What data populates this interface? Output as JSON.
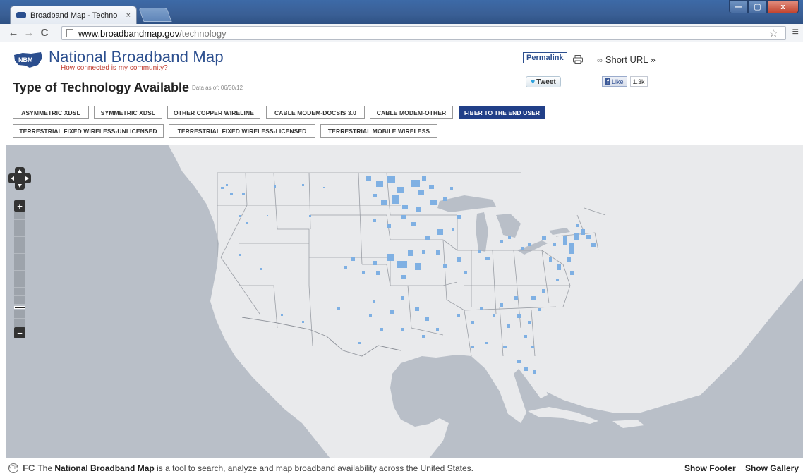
{
  "browser": {
    "tab_title": "Broadband Map - Techno",
    "tab_close": "×",
    "url_host": "www.broadbandmap.gov",
    "url_path": "/technology",
    "window_min": "—",
    "window_max": "▢",
    "window_close": "x"
  },
  "header": {
    "logo_text": "NBM",
    "site_title": "National Broadband Map",
    "tagline": "How connected is my community?",
    "page_heading": "Type of Technology Available",
    "data_as_of": "Data as of: 06/30/12",
    "permalink": "Permalink",
    "short_url": "Short URL »",
    "tweet": "Tweet",
    "fb_like": "Like",
    "fb_count": "1.3k"
  },
  "technologies": [
    {
      "label": "ASYMMETRIC XDSL",
      "active": false
    },
    {
      "label": "SYMMETRIC XDSL",
      "active": false
    },
    {
      "label": "OTHER COPPER WIRELINE",
      "active": false
    },
    {
      "label": "CABLE MODEM-DOCSIS 3.0",
      "active": false
    },
    {
      "label": "CABLE MODEM-OTHER",
      "active": false
    },
    {
      "label": "FIBER TO THE END USER",
      "active": true
    },
    {
      "label": "TERRESTRIAL FIXED WIRELESS-UNLICENSED",
      "active": false
    },
    {
      "label": "TERRESTRIAL FIXED WIRELESS-LICENSED",
      "active": false
    },
    {
      "label": "TERRESTRIAL MOBILE WIRELESS",
      "active": false
    }
  ],
  "map": {
    "zoom_in": "+",
    "zoom_out": "−",
    "zoom_level_fraction": 0.8,
    "colors": {
      "ocean": "#b9bfc8",
      "land": "#e9eaec",
      "coverage": "#7fb0e3",
      "borders": "#9a9ea5"
    }
  },
  "footer": {
    "fcc": "FC",
    "text_prefix": "The",
    "text_bold": "National Broadband Map",
    "text_rest": "is a tool to search, analyze and map broadband availability across the United States.",
    "show_footer": "Show Footer",
    "show_gallery": "Show Gallery"
  }
}
